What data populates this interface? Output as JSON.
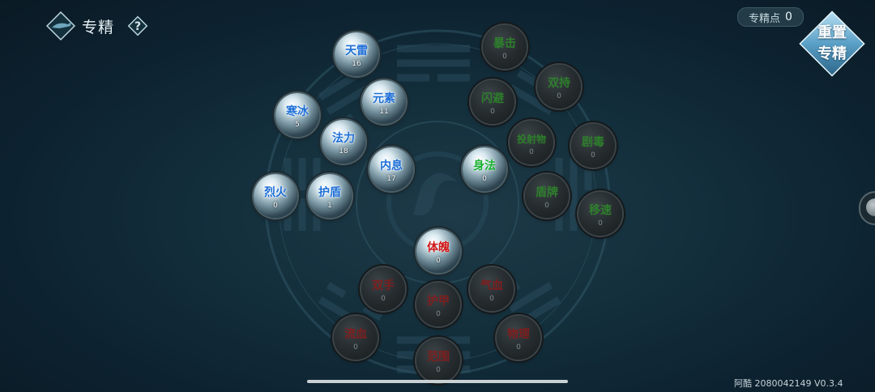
{
  "header": {
    "title": "专精",
    "back_icon": "whale-back-icon",
    "help_icon": "question-icon"
  },
  "points": {
    "label": "专精点",
    "value": "0"
  },
  "reset_button": {
    "line1": "重置",
    "line2": "专精"
  },
  "version_text": "阿酷 2080042149 V0.3.4",
  "colors": {
    "blue": "#1f6fd6",
    "green": "#18b030",
    "red": "#d01818"
  },
  "nodes": [
    {
      "key": "tianlei",
      "label": "天雷",
      "value": "16",
      "style": "blue"
    },
    {
      "key": "yuansu",
      "label": "元素",
      "value": "11",
      "style": "blue"
    },
    {
      "key": "hanbing",
      "label": "寒冰",
      "value": "5",
      "style": "blue"
    },
    {
      "key": "fali",
      "label": "法力",
      "value": "18",
      "style": "blue"
    },
    {
      "key": "neixi",
      "label": "内息",
      "value": "17",
      "style": "blue"
    },
    {
      "key": "liehuo",
      "label": "烈火",
      "value": "0",
      "style": "blue"
    },
    {
      "key": "hudun",
      "label": "护盾",
      "value": "1",
      "style": "blue"
    },
    {
      "key": "baoji",
      "label": "暴击",
      "value": "0",
      "style": "dark-green"
    },
    {
      "key": "shuangchi",
      "label": "双持",
      "value": "0",
      "style": "dark-green"
    },
    {
      "key": "shanbi",
      "label": "闪避",
      "value": "0",
      "style": "dark-green"
    },
    {
      "key": "toushewu",
      "label": "投射物",
      "value": "0",
      "style": "dark-green"
    },
    {
      "key": "judu",
      "label": "剧毒",
      "value": "0",
      "style": "dark-green"
    },
    {
      "key": "shenfa",
      "label": "身法",
      "value": "0",
      "style": "active-green"
    },
    {
      "key": "dunpai",
      "label": "盾牌",
      "value": "0",
      "style": "dark-green"
    },
    {
      "key": "yisu",
      "label": "移速",
      "value": "0",
      "style": "dark-green"
    },
    {
      "key": "tipo",
      "label": "体魄",
      "value": "0",
      "style": "active-red"
    },
    {
      "key": "shuangshou",
      "label": "双手",
      "value": "0",
      "style": "dark-red"
    },
    {
      "key": "qixue",
      "label": "气血",
      "value": "0",
      "style": "dark-red"
    },
    {
      "key": "hujia",
      "label": "护甲",
      "value": "0",
      "style": "dark-red"
    },
    {
      "key": "liuxue",
      "label": "流血",
      "value": "0",
      "style": "dark-red"
    },
    {
      "key": "wuli",
      "label": "物理",
      "value": "0",
      "style": "dark-red"
    },
    {
      "key": "fanwei",
      "label": "范围",
      "value": "0",
      "style": "dark-red"
    }
  ]
}
